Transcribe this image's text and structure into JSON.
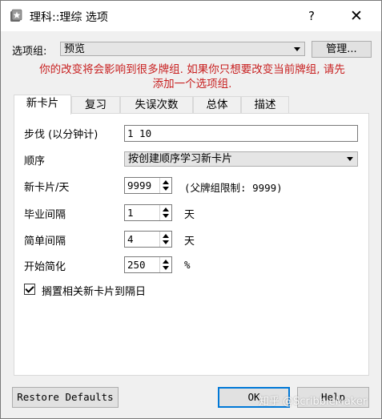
{
  "window": {
    "title": "理科::理综 选项",
    "help_label": "?",
    "close_label": "✕"
  },
  "group": {
    "label": "选项组:",
    "selected": "预览",
    "manage_label": "管理..."
  },
  "warning": {
    "line1": "你的改变将会影响到很多牌组. 如果你只想要改变当前牌组, 请先",
    "line2": "添加一个选项组.",
    "color": "#c82020"
  },
  "tabs": [
    {
      "label": "新卡片",
      "active": true
    },
    {
      "label": "复习"
    },
    {
      "label": "失误次数"
    },
    {
      "label": "总体"
    },
    {
      "label": "描述"
    }
  ],
  "new_cards": {
    "steps_label": "步伐 (以分钟计)",
    "steps_value": "1 10",
    "order_label": "顺序",
    "order_value": "按创建顺序学习新卡片",
    "per_day_label": "新卡片/天",
    "per_day_value": "9999",
    "per_day_note": "(父牌组限制: 9999)",
    "grad_label": "毕业间隔",
    "grad_value": "1",
    "grad_unit": "天",
    "easy_label": "简单间隔",
    "easy_value": "4",
    "easy_unit": "天",
    "ease_label": "开始简化",
    "ease_value": "250",
    "ease_unit": "%",
    "bury_label": "搁置相关新卡片到隔日",
    "bury_checked": true
  },
  "footer": {
    "restore_label": "Restore Defaults",
    "ok_label": "OK",
    "help_label": "Help"
  },
  "watermark": "知乎 @ScribbleMaker"
}
